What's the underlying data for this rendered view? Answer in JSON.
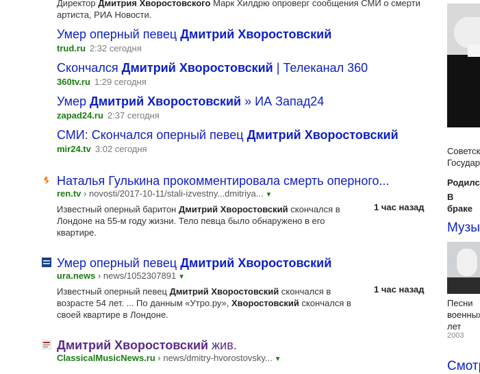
{
  "top_snippet": {
    "line1_a": "Директор ",
    "line1_b": "Дмитрия Хворостовского",
    "line1_c": " Марк Хилдрю опроверг сообщения СМИ о смерти",
    "line2": "артиста, РИА Новости."
  },
  "news": [
    {
      "t_a": "Умер оперный певец ",
      "t_b": "Дмитрий Хворостовский",
      "t_c": "",
      "domain": "trud.ru",
      "time": "2:32 сегодня"
    },
    {
      "t_a": "Скончался ",
      "t_b": "Дмитрий Хворостовский",
      "t_c": " | Телеканал 360",
      "domain": "360tv.ru",
      "time": "1:29 сегодня"
    },
    {
      "t_a": "Умер ",
      "t_b": "Дмитрий Хворостовский",
      "t_c": " » ИА Запад24",
      "domain": "zapad24.ru",
      "time": "2:37 сегодня"
    },
    {
      "t_a": "СМИ: Скончался оперный певец ",
      "t_b": "Дмитрий Хворостовский",
      "t_c": "",
      "domain": "mir24.tv",
      "time": "3:02 сегодня"
    }
  ],
  "results": [
    {
      "title_a": "Наталья Гулькина прокомментировала смерть оперного...",
      "domain": "ren.tv",
      "path": " › novosti/2017-10-11/stali-izvestny...dmitriya...",
      "ago": "1 час назад",
      "s1_a": "Известный оперный баритон ",
      "s1_b": "Дмитрий Хворостовский",
      "s1_c": " скончался в",
      "s2": "Лондоне на 55-м году жизни. Тело певца было обнаружено в его",
      "s3": "квартире."
    },
    {
      "title_a": "Умер оперный певец ",
      "title_b": "Дмитрий Хворостовский",
      "domain": "ura.news",
      "path": " › news/1052307891",
      "ago": "1 час назад",
      "s1_a": "Известный оперный певец ",
      "s1_b": "Дмитрий Хворостовский",
      "s1_c": " скончался в",
      "s2_a": "возрасте 54 лет. ... По данным «Утро.ру», ",
      "s2_b": "Хворостовский",
      "s2_c": " скончался в",
      "s3": "своей квартире в Лондоне."
    },
    {
      "title_a": "Дмитрий Хворостовский",
      "title_b": " жив.",
      "domain": "ClassicalMusicNews.ru",
      "path": " › news/dmitry-hvorostovsky..."
    }
  ],
  "sidebar": {
    "desc1": "Советск",
    "desc2": "Государ",
    "born": "Родилс",
    "married": "В браке",
    "music_title": "Музы",
    "album_line1": "Песни",
    "album_line2": "военных",
    "album_line3": "лет",
    "album_year": "2003",
    "bottom_title": "Смотр"
  }
}
